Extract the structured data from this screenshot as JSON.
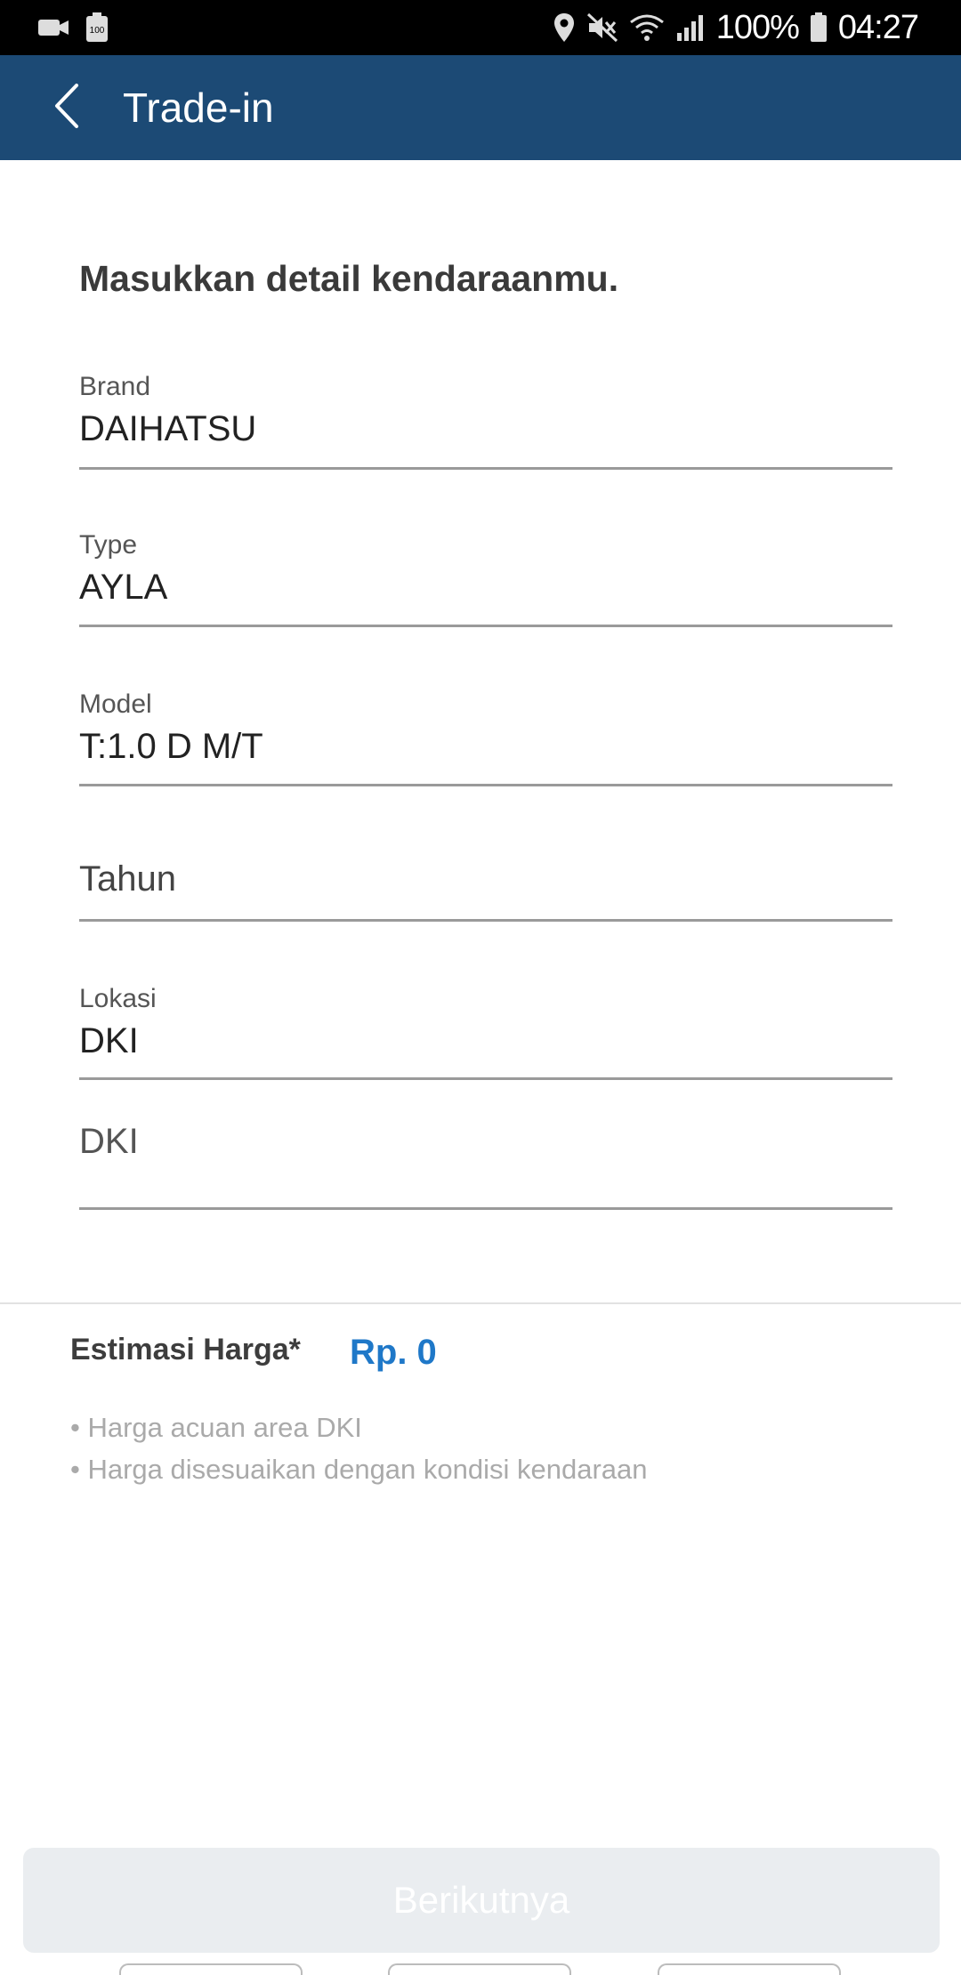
{
  "status_bar": {
    "battery_percent": "100%",
    "time": "04:27",
    "left_icons": [
      "video-camera-icon",
      "battery-saver-icon"
    ],
    "right_icons": [
      "location-icon",
      "mute-icon",
      "wifi-icon",
      "signal-icon",
      "battery-icon"
    ]
  },
  "app_bar": {
    "title": "Trade-in",
    "background": "#1c4a75"
  },
  "form": {
    "heading": "Masukkan detail kendaraanmu.",
    "brand": {
      "label": "Brand",
      "value": "DAIHATSU"
    },
    "type": {
      "label": "Type",
      "value": "AYLA"
    },
    "model": {
      "label": "Model",
      "value": "T:1.0 D M/T"
    },
    "year": {
      "placeholder": "Tahun"
    },
    "location": {
      "label": "Lokasi",
      "value": "DKI"
    },
    "region": {
      "value": "DKI"
    }
  },
  "estimate": {
    "label": "Estimasi Harga*",
    "value": "Rp. 0",
    "accent": "#1f78c8",
    "notes": [
      "• Harga acuan area DKI",
      "• Harga disesuaikan dengan kondisi kendaraan"
    ]
  },
  "footer": {
    "next_button": "Berikutnya"
  }
}
